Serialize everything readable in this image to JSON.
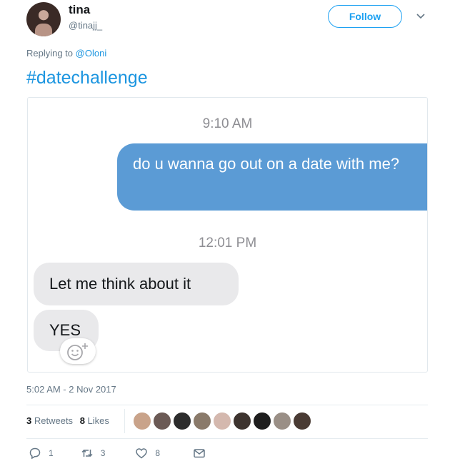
{
  "user": {
    "display_name": "tina",
    "handle": "@tinajj_"
  },
  "follow_label": "Follow",
  "reply": {
    "prefix": "Replying to",
    "mention": "@Oloni"
  },
  "tweet_text": "#datechallenge",
  "screenshot": {
    "time_1": "9:10 AM",
    "sent_message": "do u wanna go out on a date with me?",
    "time_2": "12:01 PM",
    "received_1": "Let me think about it",
    "received_2": "YES"
  },
  "tweet_time": "5:02 AM - 2 Nov 2017",
  "stats": {
    "retweets_count": "3",
    "retweets_label": "Retweets",
    "likes_count": "8",
    "likes_label": "Likes"
  },
  "liker_colors": [
    "#c9a38a",
    "#6b5a55",
    "#2c2c2c",
    "#8a7a6a",
    "#d4b8ae",
    "#3d342f",
    "#1e1e1e",
    "#9a8f86",
    "#4a3b34"
  ],
  "actions": {
    "reply_count": "1",
    "retweet_count": "3",
    "like_count": "8"
  },
  "colors": {
    "accent": "#1da1f2",
    "link": "#1b95e0",
    "sent_bubble": "#5b9bd5",
    "received_bubble": "#e9e9eb"
  }
}
